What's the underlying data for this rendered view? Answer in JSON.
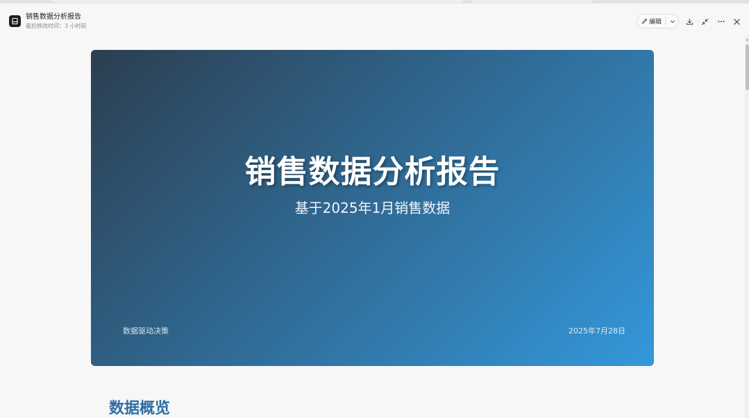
{
  "app": {
    "title": "销售数据分析报告",
    "last_modified": "最后修改时间：3 小时前",
    "icon": "document-app-icon"
  },
  "toolbar": {
    "edit_label": "编辑",
    "icons": [
      "pencil-icon",
      "chevron-down-icon",
      "download-icon",
      "collapse-icon",
      "more-icon",
      "close-icon"
    ]
  },
  "slide": {
    "title": "销售数据分析报告",
    "subtitle": "基于2025年1月销售数据",
    "footer_left": "数据驱动决策",
    "footer_right": "2025年7月28日"
  },
  "section": {
    "heading": "数据概览"
  },
  "colors": {
    "page_bg": "#f7f7f7",
    "slide_gradient_start": "#2c3e50",
    "slide_gradient_end": "#3498db",
    "section_heading": "#2e6da4"
  }
}
